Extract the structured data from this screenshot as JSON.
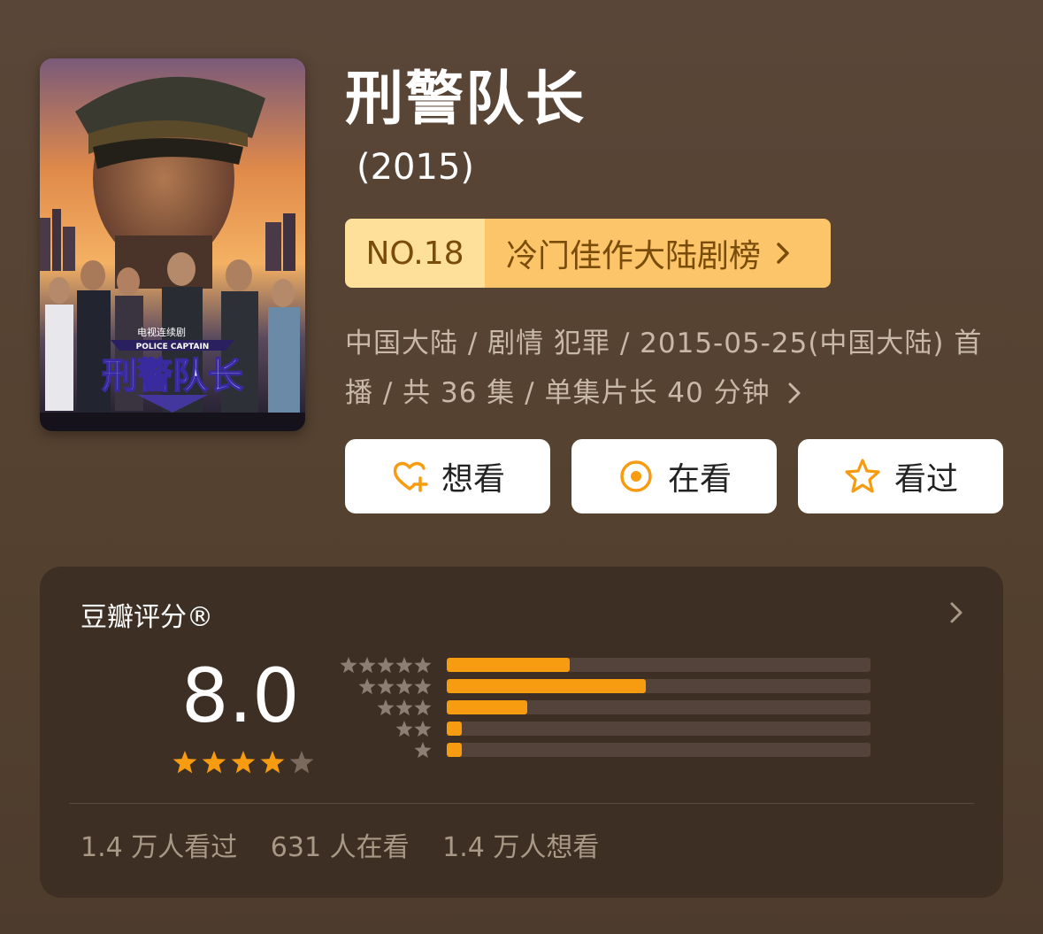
{
  "poster": {
    "series_tag": "电视连续剧",
    "english_title": "POLICE CAPTAIN",
    "logo_title": "刑警队长"
  },
  "title": "刑警队长",
  "year": "(2015)",
  "ranking": {
    "number": "NO.18",
    "list_name": "冷门佳作大陆剧榜"
  },
  "meta": {
    "text": "中国大陆 / 剧情 犯罪 / 2015-05-25(中国大陆) 首播 / 共 36 集 / 单集片长 40 分钟"
  },
  "actions": {
    "want": "想看",
    "watching": "在看",
    "watched": "看过"
  },
  "rating": {
    "label": "豆瓣评分®",
    "score": "8.0",
    "stars_filled": 4,
    "stars_total": 5,
    "distribution": [
      {
        "stars": 5,
        "fraction": 0.29
      },
      {
        "stars": 4,
        "fraction": 0.47
      },
      {
        "stars": 3,
        "fraction": 0.19
      },
      {
        "stars": 2,
        "fraction": 0.03
      },
      {
        "stars": 1,
        "fraction": 0.03
      }
    ],
    "stats": {
      "watched": "1.4 万人看过",
      "watching": "631 人在看",
      "want": "1.4 万人想看"
    }
  },
  "colors": {
    "accent": "#f79b11",
    "badge_left": "#ffe09a",
    "badge_right": "#fcc56a",
    "card_bg": "#3e2f24"
  }
}
